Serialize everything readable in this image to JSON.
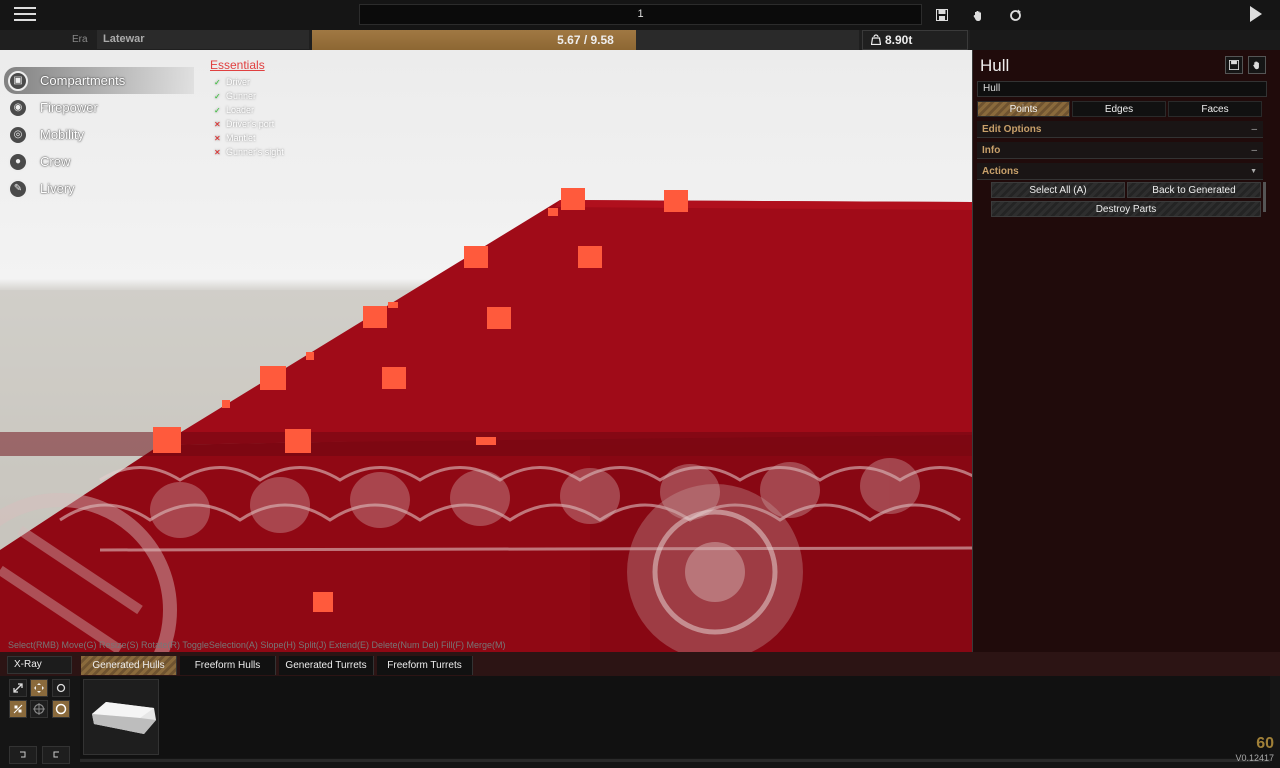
{
  "toolbar": {
    "vehicle_name": "1",
    "icons": [
      "menu-icon",
      "save-icon",
      "hand-icon",
      "refresh-icon",
      "play-icon"
    ]
  },
  "stats": {
    "era_label": "Era",
    "era_value": "Latewar",
    "weight_text": "5.67 / 9.58",
    "weight_fraction": 0.592,
    "tonnage": "8.90t",
    "accent_color": "#a07843"
  },
  "categories": [
    {
      "label": "Compartments",
      "icon": "box-icon",
      "active": true
    },
    {
      "label": "Firepower",
      "icon": "cannon-icon",
      "active": false
    },
    {
      "label": "Mobility",
      "icon": "wheel-icon",
      "active": false
    },
    {
      "label": "Crew",
      "icon": "person-icon",
      "active": false
    },
    {
      "label": "Livery",
      "icon": "brush-icon",
      "active": false
    }
  ],
  "essentials": {
    "title": "Essentials",
    "items": [
      {
        "label": "Driver",
        "ok": true
      },
      {
        "label": "Gunner",
        "ok": true
      },
      {
        "label": "Loader",
        "ok": true
      },
      {
        "label": "Driver's port",
        "ok": false
      },
      {
        "label": "Mantlet",
        "ok": false
      },
      {
        "label": "Gunner's sight",
        "ok": false
      }
    ]
  },
  "hints": "Select(RMB) Move(G) Resize(S) Rotate(R) ToggleSelection(A) Slope(H) Split(J) Extend(E) Delete(Num Del) Fill(F) Merge(M)",
  "panel": {
    "title": "Hull",
    "name_value": "Hull",
    "tabs": [
      "Points",
      "Edges",
      "Faces"
    ],
    "sections": {
      "edit_options": "Edit Options",
      "info": "Info",
      "actions": "Actions",
      "collapsed_mark": "–",
      "expanded_mark": "▼"
    },
    "actions": {
      "select_all": "Select All (A)",
      "back_to_generated": "Back to Generated",
      "destroy_parts": "Destroy Parts"
    }
  },
  "bottom": {
    "xray": "X-Ray",
    "tabs": [
      "Generated Hulls",
      "Freeform Hulls",
      "Generated Turrets",
      "Freeform Turrets"
    ],
    "fps": "60",
    "version": "V0.12417"
  }
}
